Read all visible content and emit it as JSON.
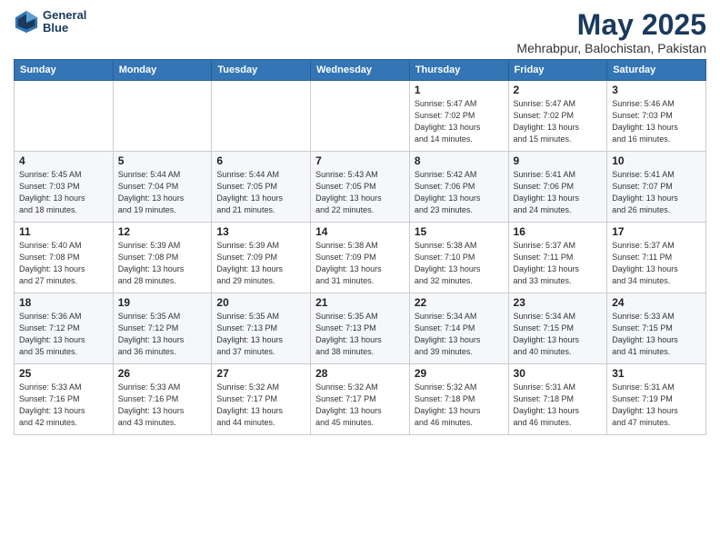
{
  "header": {
    "logo_line1": "General",
    "logo_line2": "Blue",
    "month_year": "May 2025",
    "location": "Mehrabpur, Balochistan, Pakistan"
  },
  "weekdays": [
    "Sunday",
    "Monday",
    "Tuesday",
    "Wednesday",
    "Thursday",
    "Friday",
    "Saturday"
  ],
  "weeks": [
    [
      {
        "day": "",
        "info": ""
      },
      {
        "day": "",
        "info": ""
      },
      {
        "day": "",
        "info": ""
      },
      {
        "day": "",
        "info": ""
      },
      {
        "day": "1",
        "info": "Sunrise: 5:47 AM\nSunset: 7:02 PM\nDaylight: 13 hours\nand 14 minutes."
      },
      {
        "day": "2",
        "info": "Sunrise: 5:47 AM\nSunset: 7:02 PM\nDaylight: 13 hours\nand 15 minutes."
      },
      {
        "day": "3",
        "info": "Sunrise: 5:46 AM\nSunset: 7:03 PM\nDaylight: 13 hours\nand 16 minutes."
      }
    ],
    [
      {
        "day": "4",
        "info": "Sunrise: 5:45 AM\nSunset: 7:03 PM\nDaylight: 13 hours\nand 18 minutes."
      },
      {
        "day": "5",
        "info": "Sunrise: 5:44 AM\nSunset: 7:04 PM\nDaylight: 13 hours\nand 19 minutes."
      },
      {
        "day": "6",
        "info": "Sunrise: 5:44 AM\nSunset: 7:05 PM\nDaylight: 13 hours\nand 21 minutes."
      },
      {
        "day": "7",
        "info": "Sunrise: 5:43 AM\nSunset: 7:05 PM\nDaylight: 13 hours\nand 22 minutes."
      },
      {
        "day": "8",
        "info": "Sunrise: 5:42 AM\nSunset: 7:06 PM\nDaylight: 13 hours\nand 23 minutes."
      },
      {
        "day": "9",
        "info": "Sunrise: 5:41 AM\nSunset: 7:06 PM\nDaylight: 13 hours\nand 24 minutes."
      },
      {
        "day": "10",
        "info": "Sunrise: 5:41 AM\nSunset: 7:07 PM\nDaylight: 13 hours\nand 26 minutes."
      }
    ],
    [
      {
        "day": "11",
        "info": "Sunrise: 5:40 AM\nSunset: 7:08 PM\nDaylight: 13 hours\nand 27 minutes."
      },
      {
        "day": "12",
        "info": "Sunrise: 5:39 AM\nSunset: 7:08 PM\nDaylight: 13 hours\nand 28 minutes."
      },
      {
        "day": "13",
        "info": "Sunrise: 5:39 AM\nSunset: 7:09 PM\nDaylight: 13 hours\nand 29 minutes."
      },
      {
        "day": "14",
        "info": "Sunrise: 5:38 AM\nSunset: 7:09 PM\nDaylight: 13 hours\nand 31 minutes."
      },
      {
        "day": "15",
        "info": "Sunrise: 5:38 AM\nSunset: 7:10 PM\nDaylight: 13 hours\nand 32 minutes."
      },
      {
        "day": "16",
        "info": "Sunrise: 5:37 AM\nSunset: 7:11 PM\nDaylight: 13 hours\nand 33 minutes."
      },
      {
        "day": "17",
        "info": "Sunrise: 5:37 AM\nSunset: 7:11 PM\nDaylight: 13 hours\nand 34 minutes."
      }
    ],
    [
      {
        "day": "18",
        "info": "Sunrise: 5:36 AM\nSunset: 7:12 PM\nDaylight: 13 hours\nand 35 minutes."
      },
      {
        "day": "19",
        "info": "Sunrise: 5:35 AM\nSunset: 7:12 PM\nDaylight: 13 hours\nand 36 minutes."
      },
      {
        "day": "20",
        "info": "Sunrise: 5:35 AM\nSunset: 7:13 PM\nDaylight: 13 hours\nand 37 minutes."
      },
      {
        "day": "21",
        "info": "Sunrise: 5:35 AM\nSunset: 7:13 PM\nDaylight: 13 hours\nand 38 minutes."
      },
      {
        "day": "22",
        "info": "Sunrise: 5:34 AM\nSunset: 7:14 PM\nDaylight: 13 hours\nand 39 minutes."
      },
      {
        "day": "23",
        "info": "Sunrise: 5:34 AM\nSunset: 7:15 PM\nDaylight: 13 hours\nand 40 minutes."
      },
      {
        "day": "24",
        "info": "Sunrise: 5:33 AM\nSunset: 7:15 PM\nDaylight: 13 hours\nand 41 minutes."
      }
    ],
    [
      {
        "day": "25",
        "info": "Sunrise: 5:33 AM\nSunset: 7:16 PM\nDaylight: 13 hours\nand 42 minutes."
      },
      {
        "day": "26",
        "info": "Sunrise: 5:33 AM\nSunset: 7:16 PM\nDaylight: 13 hours\nand 43 minutes."
      },
      {
        "day": "27",
        "info": "Sunrise: 5:32 AM\nSunset: 7:17 PM\nDaylight: 13 hours\nand 44 minutes."
      },
      {
        "day": "28",
        "info": "Sunrise: 5:32 AM\nSunset: 7:17 PM\nDaylight: 13 hours\nand 45 minutes."
      },
      {
        "day": "29",
        "info": "Sunrise: 5:32 AM\nSunset: 7:18 PM\nDaylight: 13 hours\nand 46 minutes."
      },
      {
        "day": "30",
        "info": "Sunrise: 5:31 AM\nSunset: 7:18 PM\nDaylight: 13 hours\nand 46 minutes."
      },
      {
        "day": "31",
        "info": "Sunrise: 5:31 AM\nSunset: 7:19 PM\nDaylight: 13 hours\nand 47 minutes."
      }
    ]
  ]
}
